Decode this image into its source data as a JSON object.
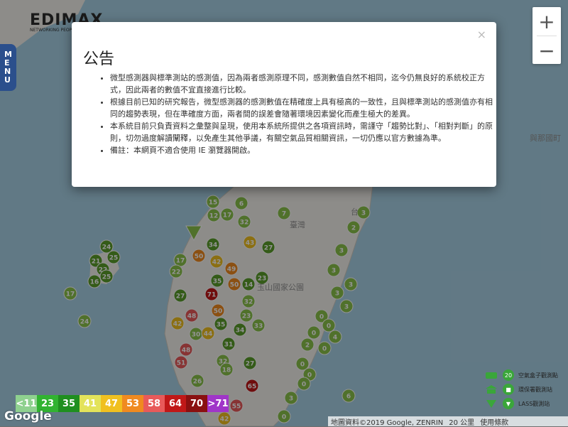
{
  "brand": {
    "logo": "EDIMAX",
    "tagline": "NETWORKING PEOPLE TOGETHER"
  },
  "menu": {
    "label": "MENU"
  },
  "zoom": {
    "in": "+",
    "out": "−"
  },
  "map_labels": {
    "city_east": "與那國町",
    "taiwan": "臺灣",
    "taipei_partial": "台",
    "park": "玉山國家公園"
  },
  "notice": {
    "title": "公告",
    "close": "×",
    "items": [
      "微型感測器與標準測站的感測值，因為兩者感測原理不同，感測數值自然不相同，迄今仍無良好的系統校正方式，因此兩者的數值不宜直接進行比較。",
      "根據目前已知的研究報告，微型感測器的感測數值在精確度上具有極高的一致性，且與標準測站的感測值亦有相同的趨勢表現，但在準確度方面，兩者間的誤差會隨著環境因素變化而產生極大的差異。",
      "本系統目前只負責資料之彙整與呈現，使用本系統所提供之各項資訊時，需謹守「趨勢比對」、「相對判斷」的原則，切勿過度解讀闡釋，以免產生其他爭議，有關空氣品質相關資訊，一切仍應以官方數據為準。",
      "備註：本網頁不適合使用 IE 瀏覽器開啟。"
    ]
  },
  "legend": [
    {
      "label": "<11",
      "color": "#8fd18f"
    },
    {
      "label": "23",
      "color": "#31b331"
    },
    {
      "label": "35",
      "color": "#1f8f1f"
    },
    {
      "label": "41",
      "color": "#e3e35a"
    },
    {
      "label": "47",
      "color": "#f0c020"
    },
    {
      "label": "53",
      "color": "#f08a20"
    },
    {
      "label": "58",
      "color": "#e85a5a"
    },
    {
      "label": "64",
      "color": "#c01818"
    },
    {
      "label": "70",
      "color": "#8a1010"
    },
    {
      "label": ">71",
      "color": "#a035c8"
    }
  ],
  "station_types": [
    {
      "label": "空氣盒子觀測點",
      "icon": "air-box-icon",
      "count": "20"
    },
    {
      "label": "環保署觀測站",
      "icon": "epa-station-icon",
      "count": ""
    },
    {
      "label": "LASS觀測站",
      "icon": "lass-station-icon",
      "count": ""
    }
  ],
  "footer": {
    "google": "Google",
    "map_data": "地圖資料©2019 Google, ZENRIN",
    "scale": "20 公里",
    "terms": "使用條款"
  },
  "markers": [
    [
      "15",
      300,
      284,
      "#8bc34a"
    ],
    [
      "17",
      320,
      302,
      "#8bc34a"
    ],
    [
      "12",
      301,
      303,
      "#8bc34a"
    ],
    [
      "6",
      340,
      286,
      "#8bc34a"
    ],
    [
      "32",
      344,
      312,
      "#8bc34a"
    ],
    [
      "34",
      300,
      344,
      "#5a9e2a"
    ],
    [
      "43",
      352,
      341,
      "#f0c020"
    ],
    [
      "27",
      378,
      348,
      "#5a9e2a"
    ],
    [
      "50",
      280,
      360,
      "#f08a20"
    ],
    [
      "17",
      254,
      366,
      "#8bc34a"
    ],
    [
      "22",
      248,
      382,
      "#8bc34a"
    ],
    [
      "42",
      305,
      368,
      "#f0c020"
    ],
    [
      "49",
      326,
      378,
      "#f08a20"
    ],
    [
      "35",
      306,
      395,
      "#5a9e2a"
    ],
    [
      "50",
      330,
      400,
      "#f08a20"
    ],
    [
      "14",
      350,
      400,
      "#5a9e2a"
    ],
    [
      "23",
      369,
      391,
      "#5a9e2a"
    ],
    [
      "27",
      254,
      416,
      "#5a9e2a"
    ],
    [
      "71",
      298,
      414,
      "#c01818"
    ],
    [
      "32",
      350,
      424,
      "#8bc34a"
    ],
    [
      "48",
      270,
      444,
      "#e85a5a"
    ],
    [
      "50",
      307,
      437,
      "#f08a20"
    ],
    [
      "23",
      347,
      444,
      "#8bc34a"
    ],
    [
      "42",
      250,
      455,
      "#f0c020"
    ],
    [
      "35",
      311,
      456,
      "#5a9e2a"
    ],
    [
      "33",
      364,
      458,
      "#8bc34a"
    ],
    [
      "30",
      276,
      470,
      "#8bc34a"
    ],
    [
      "44",
      293,
      469,
      "#f0c020"
    ],
    [
      "34",
      338,
      464,
      "#5a9e2a"
    ],
    [
      "31",
      322,
      484,
      "#5a9e2a"
    ],
    [
      "48",
      262,
      492,
      "#e85a5a"
    ],
    [
      "51",
      255,
      510,
      "#e85a5a"
    ],
    [
      "32",
      314,
      508,
      "#8bc34a"
    ],
    [
      "18",
      319,
      520,
      "#8bc34a"
    ],
    [
      "27",
      352,
      511,
      "#5a9e2a"
    ],
    [
      "26",
      278,
      536,
      "#8bc34a"
    ],
    [
      "65",
      355,
      543,
      "#c01818"
    ],
    [
      "55",
      333,
      571,
      "#e85a5a"
    ],
    [
      "42",
      316,
      589,
      "#f0c020"
    ],
    [
      "24",
      150,
      347,
      "#5a9e2a"
    ],
    [
      "25",
      160,
      362,
      "#5a9e2a"
    ],
    [
      "21",
      135,
      367,
      "#5a9e2a"
    ],
    [
      "22",
      145,
      379,
      "#5a9e2a"
    ],
    [
      "16",
      133,
      396,
      "#5a9e2a"
    ],
    [
      "25",
      150,
      389,
      "#5a9e2a"
    ],
    [
      "17",
      99,
      413,
      "#8bc34a"
    ],
    [
      "24",
      119,
      452,
      "#8bc34a"
    ],
    [
      "7",
      400,
      300,
      "#8bc34a"
    ],
    [
      "3",
      512,
      299,
      "#8bc34a"
    ],
    [
      "2",
      498,
      320,
      "#8bc34a"
    ],
    [
      "3",
      481,
      352,
      "#8bc34a"
    ],
    [
      "3",
      470,
      380,
      "#8bc34a"
    ],
    [
      "3",
      494,
      400,
      "#8bc34a"
    ],
    [
      "3",
      475,
      412,
      "#8bc34a"
    ],
    [
      "3",
      488,
      431,
      "#8bc34a"
    ],
    [
      "0",
      453,
      445,
      "#8bc34a"
    ],
    [
      "0",
      463,
      458,
      "#8bc34a"
    ],
    [
      "0",
      442,
      468,
      "#8bc34a"
    ],
    [
      "4",
      472,
      474,
      "#8bc34a"
    ],
    [
      "2",
      433,
      485,
      "#8bc34a"
    ],
    [
      "0",
      457,
      490,
      "#8bc34a"
    ],
    [
      "0",
      426,
      512,
      "#8bc34a"
    ],
    [
      "0",
      436,
      527,
      "#8bc34a"
    ],
    [
      "0",
      428,
      540,
      "#8bc34a"
    ],
    [
      "3",
      410,
      560,
      "#8bc34a"
    ],
    [
      "0",
      400,
      586,
      "#8bc34a"
    ],
    [
      "6",
      491,
      557,
      "#8bc34a"
    ]
  ]
}
